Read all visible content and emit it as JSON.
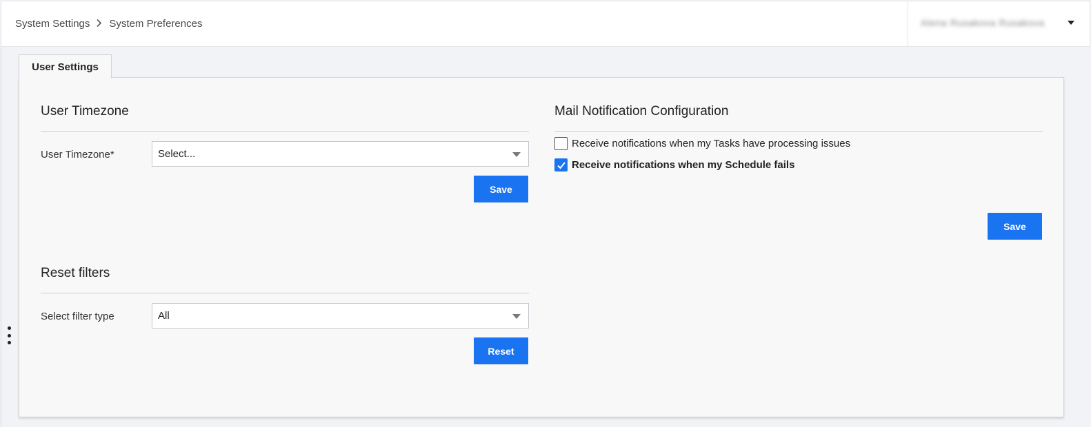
{
  "breadcrumb": {
    "items": [
      "System Settings",
      "System Preferences"
    ],
    "separator_icon": "chevron-right-icon"
  },
  "user_menu": {
    "name": "Alena Rusakova Rusakova",
    "caret_icon": "caret-down-icon"
  },
  "tabs": [
    {
      "label": "User Settings",
      "active": true
    }
  ],
  "timezone": {
    "title": "User Timezone",
    "field_label": "User Timezone*",
    "select_value": "Select...",
    "save_label": "Save"
  },
  "reset_filters": {
    "title": "Reset filters",
    "field_label": "Select filter type",
    "select_value": "All",
    "reset_label": "Reset"
  },
  "mail": {
    "title": "Mail Notification Configuration",
    "options": [
      {
        "label": "Receive notifications when my Tasks have processing issues",
        "checked": false
      },
      {
        "label": "Receive notifications when my Schedule fails",
        "checked": true
      }
    ],
    "save_label": "Save"
  },
  "colors": {
    "accent": "#1a73f0",
    "page_bg": "#f2f3f6",
    "panel_bg": "#f8f8f9"
  }
}
